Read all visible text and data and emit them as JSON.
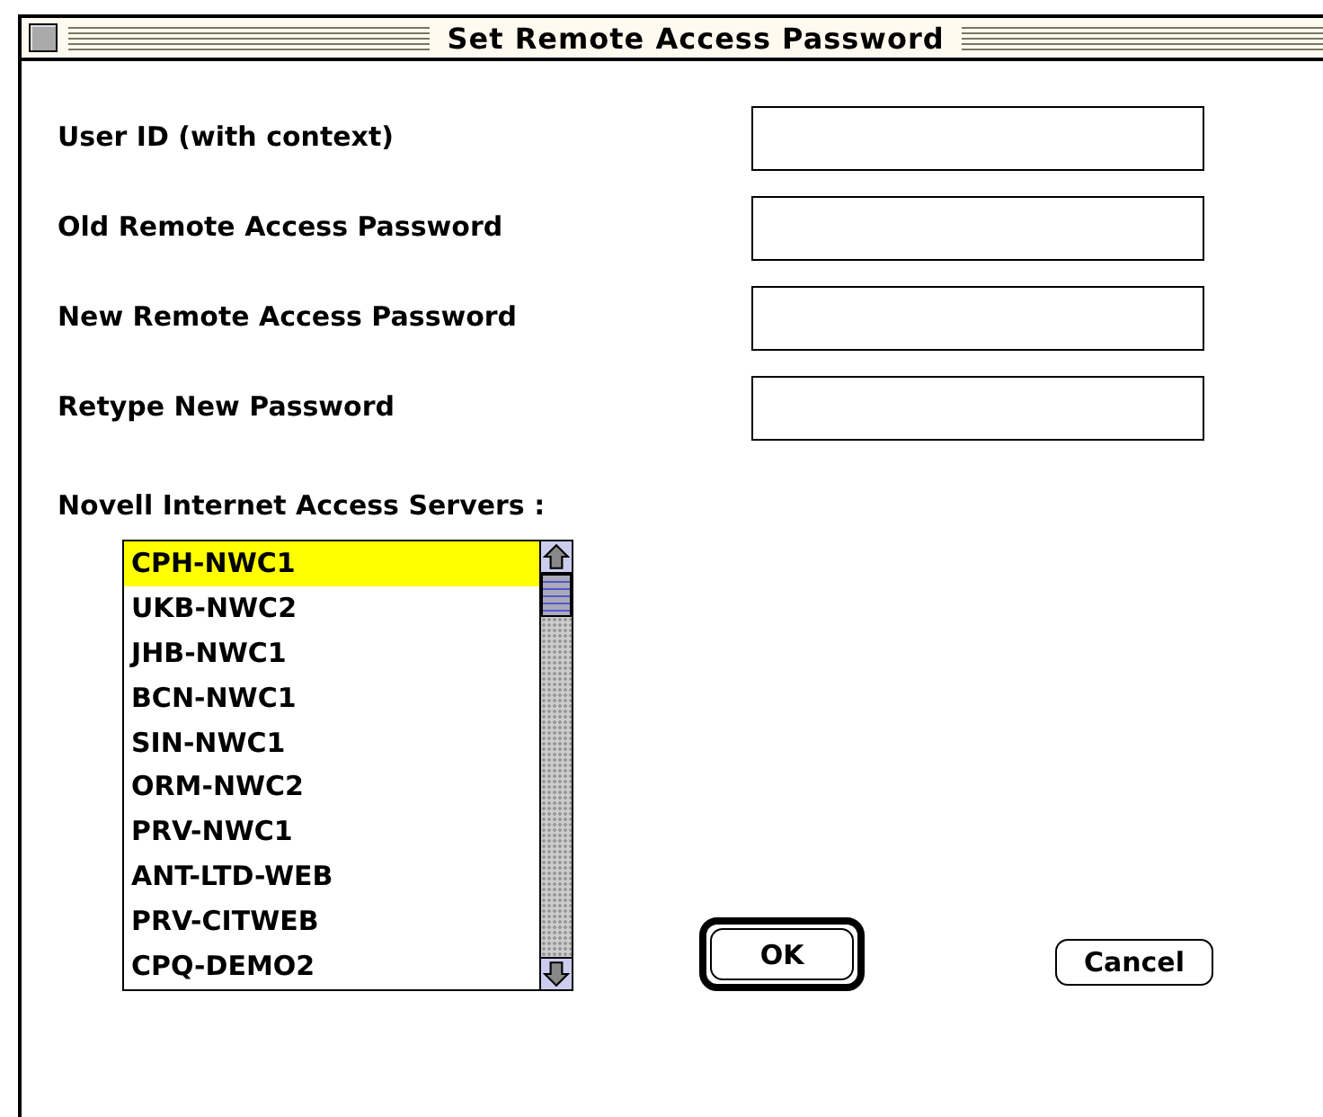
{
  "window": {
    "title": "Set Remote Access Password"
  },
  "fields": [
    {
      "label": "User ID (with context)"
    },
    {
      "label": "Old Remote Access Password"
    },
    {
      "label": "New Remote Access Password"
    },
    {
      "label": "Retype New Password"
    }
  ],
  "servers": {
    "label": "Novell Internet Access Servers :",
    "items": [
      {
        "name": "CPH-NWC1",
        "selected": true
      },
      {
        "name": "UKB-NWC2",
        "selected": false
      },
      {
        "name": "JHB-NWC1",
        "selected": false
      },
      {
        "name": "BCN-NWC1",
        "selected": false
      },
      {
        "name": "SIN-NWC1",
        "selected": false
      },
      {
        "name": "ORM-NWC2",
        "selected": false
      },
      {
        "name": "PRV-NWC1",
        "selected": false
      },
      {
        "name": "ANT-LTD-WEB",
        "selected": false
      },
      {
        "name": "PRV-CITWEB",
        "selected": false
      },
      {
        "name": "CPQ-DEMO2",
        "selected": false
      }
    ]
  },
  "buttons": [
    {
      "label": "OK",
      "kind": "default"
    },
    {
      "label": "Cancel",
      "kind": "normal"
    }
  ]
}
